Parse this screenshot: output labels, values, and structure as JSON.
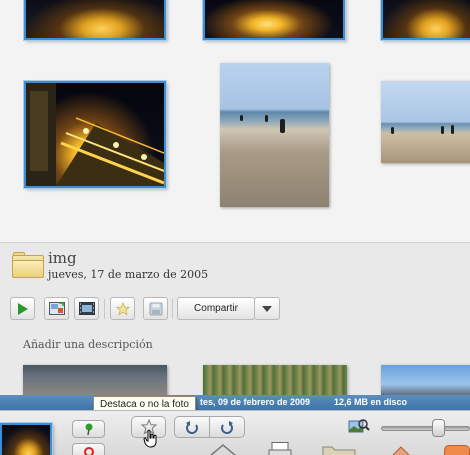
{
  "gallery": {
    "thumbnails": [
      {
        "name": "night-city-1",
        "kind": "night",
        "selected": true
      },
      {
        "name": "night-city-2",
        "kind": "night",
        "selected": true
      },
      {
        "name": "night-city-3",
        "kind": "night",
        "selected": true
      },
      {
        "name": "night-avenue",
        "kind": "night",
        "selected": true
      },
      {
        "name": "beach-child",
        "kind": "beach",
        "selected": false
      },
      {
        "name": "beach-people",
        "kind": "beach",
        "selected": false
      }
    ]
  },
  "folder": {
    "name": "img",
    "date": "jueves, 17 de marzo de 2005",
    "icon": "folder-icon"
  },
  "toolbar": {
    "play_icon": "play-icon",
    "share_label": "Compartir",
    "share_dropdown_icon": "chevron-down-icon"
  },
  "description_placeholder": "Añadir una descripción",
  "status_bar": {
    "date": "tes, 09 de febrero de 2009",
    "size": "12,6 MB en disco"
  },
  "tooltip": "Destaca o no la foto",
  "colors": {
    "selection_border": "#3c8fd4",
    "status_bar": "#4a80b2",
    "play_green": "#2a9a2a"
  }
}
